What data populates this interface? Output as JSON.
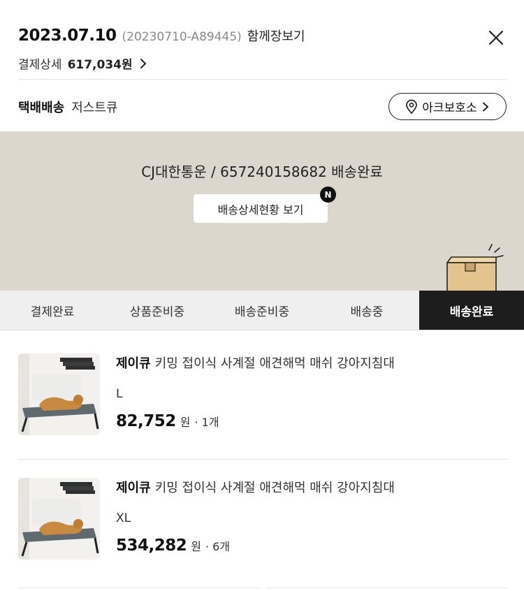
{
  "order": {
    "date": "2023.07.10",
    "number": "(20230710-A89445)",
    "together_label": "함께장보기",
    "payment_label": "결제상세",
    "payment_amount": "617,034원"
  },
  "shipping": {
    "type_label": "택배배송",
    "sub_label": "저스트큐",
    "pickup_label": "아크보호소"
  },
  "tracking": {
    "text": "CJ대한통운 / 657240158682 배송완료",
    "detail_button": "배송상세현황 보기",
    "badge": "N"
  },
  "steps": [
    {
      "label": "결제완료",
      "active": false
    },
    {
      "label": "상품준비중",
      "active": false
    },
    {
      "label": "배송준비중",
      "active": false
    },
    {
      "label": "배송중",
      "active": false
    },
    {
      "label": "배송완료",
      "active": true
    }
  ],
  "products": [
    {
      "brand": "제이큐",
      "name": "키밍 접이식 사계절 애견해먹 매쉬 강아지침대",
      "option": "L",
      "price": "82,752",
      "currency": "원",
      "quantity": "· 1개"
    },
    {
      "brand": "제이큐",
      "name": "키밍 접이식 사계절 애견해먹 매쉬 강아지침대",
      "option": "XL",
      "price": "534,282",
      "currency": "원",
      "quantity": "· 6개"
    }
  ],
  "icons": {
    "close": "close-icon",
    "chevron": "chevron-right-icon",
    "pin": "location-pin-icon",
    "box": "box-icon"
  },
  "colors": {
    "tracking_bg": "#dcd7cc",
    "active_step_bg": "#1d1d1d",
    "box": "#e2c48c"
  }
}
